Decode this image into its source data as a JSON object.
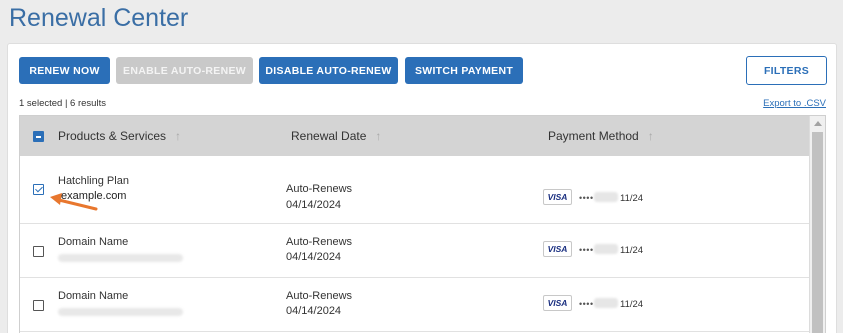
{
  "page": {
    "title": "Renewal Center"
  },
  "toolbar": {
    "renew_now": "RENEW NOW",
    "enable_auto_renew": "ENABLE AUTO-RENEW",
    "disable_auto_renew": "DISABLE AUTO-RENEW",
    "switch_payment": "SWITCH PAYMENT",
    "filters": "FILTERS"
  },
  "status": {
    "selection_summary": "1 selected | 6 results",
    "export_link": "Export to .CSV"
  },
  "table": {
    "columns": [
      {
        "label": "Products & Services",
        "sort_icon": "sort-arrow-icon"
      },
      {
        "label": "Renewal Date",
        "sort_icon": "sort-arrow-icon"
      },
      {
        "label": "Payment Method",
        "sort_icon": "sort-arrow-icon"
      }
    ],
    "rows": [
      {
        "checked": true,
        "product": "Hatchling Plan",
        "domain": ".example.com",
        "renewal_status": "Auto-Renews",
        "renewal_date": "04/14/2024",
        "card_brand": "VISA",
        "card_mask": "••••",
        "card_expiry": "11/24"
      },
      {
        "checked": false,
        "product": "Domain Name",
        "domain": "",
        "renewal_status": "Auto-Renews",
        "renewal_date": "04/14/2024",
        "card_brand": "VISA",
        "card_mask": "••••",
        "card_expiry": "11/24"
      },
      {
        "checked": false,
        "product": "Domain Name",
        "domain": "",
        "renewal_status": "Auto-Renews",
        "renewal_date": "04/14/2024",
        "card_brand": "VISA",
        "card_mask": "••••",
        "card_expiry": "11/24"
      }
    ]
  },
  "colors": {
    "accent": "#2b6fb8",
    "title": "#3a6ea5",
    "annotation_arrow": "#e8772e",
    "header_bg": "#d4d4d4"
  }
}
